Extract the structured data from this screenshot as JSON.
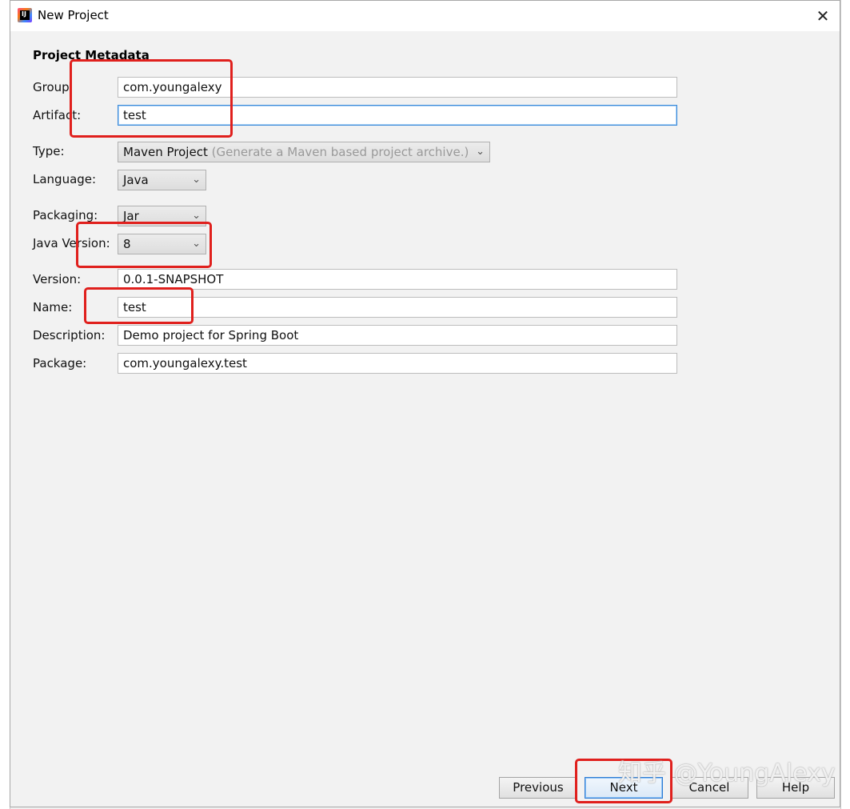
{
  "window": {
    "title": "New Project",
    "close_glyph": "✕"
  },
  "section_title": "Project Metadata",
  "fields": {
    "group": {
      "label": "Group",
      "value": "com.youngalexy"
    },
    "artifact": {
      "label": "Artifact:",
      "value": "test"
    },
    "type": {
      "label": "Type:",
      "value": "Maven Project",
      "hint": "(Generate a Maven based project archive.)"
    },
    "language": {
      "label": "Language:",
      "value": "Java"
    },
    "packaging": {
      "label": "Packaging:",
      "value": "Jar"
    },
    "java_version": {
      "label": "Java Version:",
      "value": "8"
    },
    "version": {
      "label": "Version:",
      "value": "0.0.1-SNAPSHOT"
    },
    "name": {
      "label": "Name:",
      "value": "test"
    },
    "description": {
      "label": "Description:",
      "value": "Demo project for Spring Boot"
    },
    "package": {
      "label": "Package:",
      "value": "com.youngalexy.test"
    }
  },
  "buttons": {
    "previous": "Previous",
    "next": "Next",
    "cancel": "Cancel",
    "help": "Help"
  },
  "watermark": "知乎 @YoungAlexy",
  "colors": {
    "highlight": "#e0201d",
    "focus": "#3c8bd9"
  }
}
